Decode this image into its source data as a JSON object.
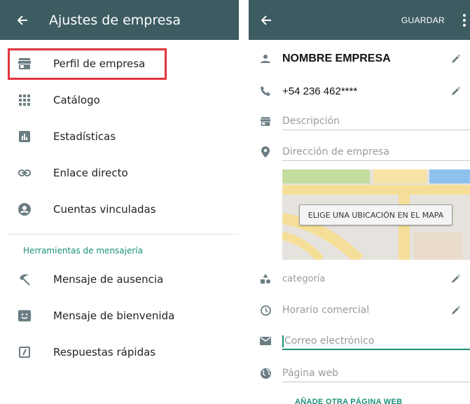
{
  "left_panel": {
    "title": "Ajustes de empresa",
    "items": [
      {
        "label": "Perfil de empresa",
        "icon": "store-icon"
      },
      {
        "label": "Catálogo",
        "icon": "grid-icon"
      },
      {
        "label": "Estadísticas",
        "icon": "bar-chart-icon"
      },
      {
        "label": "Enlace directo",
        "icon": "link-icon"
      },
      {
        "label": "Cuentas vinculadas",
        "icon": "account-circle-icon"
      }
    ],
    "section_title": "Herramientas de mensajería",
    "tools": [
      {
        "label": "Mensaje de ausencia",
        "icon": "beach-umbrella-icon"
      },
      {
        "label": "Mensaje de bienvenida",
        "icon": "smile-message-icon"
      },
      {
        "label": "Respuestas rápidas",
        "icon": "quick-reply-icon"
      }
    ],
    "highlighted_item": "Perfil de empresa"
  },
  "right_panel": {
    "save_label": "GUARDAR",
    "business_name": "NOMBRE EMPRESA",
    "phone": "+54 236 462****",
    "description_placeholder": "Descripción",
    "address_placeholder": "Dirección de empresa",
    "map_button": "ELIGE UNA UBICACIÓN EN EL MAPA",
    "category_placeholder": "categoría",
    "hours_placeholder": "Horario comercial",
    "email_placeholder": "Correo electrónico",
    "website_placeholder": "Página web",
    "add_website": "AÑADE OTRA PÁGINA WEB"
  },
  "colors": {
    "appbar": "#3d5c62",
    "accent": "#1a9078",
    "icon_gray": "#6b7d83",
    "highlight_border": "#e0353d"
  }
}
